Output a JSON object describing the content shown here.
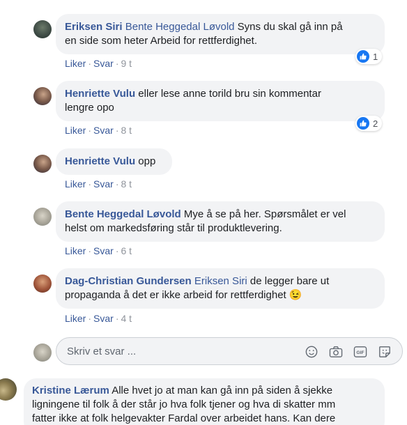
{
  "replies": [
    {
      "author": "Eriksen Siri",
      "mention": "Bente Heggedal Løvold",
      "text_line1": " Syns du skal gå inn på",
      "text_line2": "en side som heter Arbeid for rettferdighet.",
      "like": "Liker",
      "reply": "Svar",
      "time": "9 t",
      "reaction_count": "1"
    },
    {
      "author": "Henriette Vulu",
      "text_line1": " eller lese anne torild bru sin kommentar",
      "text_line2": "lengre opo",
      "like": "Liker",
      "reply": "Svar",
      "time": "8 t",
      "reaction_count": "2"
    },
    {
      "author": "Henriette Vulu",
      "text_line1": " opp",
      "like": "Liker",
      "reply": "Svar",
      "time": "8 t"
    },
    {
      "author": "Bente Heggedal Løvold",
      "text_line1": " Mye å se på her. Spørsmålet er vel",
      "text_line2": "helst om markedsføring står til produktlevering.",
      "like": "Liker",
      "reply": "Svar",
      "time": "6 t"
    },
    {
      "author": "Dag-Christian Gundersen",
      "mention": "Eriksen Siri",
      "text_line1": " de legger bare ut",
      "text_line2": "propaganda å det er ikke arbeid for rettferdighet",
      "emoji": "😉",
      "like": "Liker",
      "reply": "Svar",
      "time": "4 t"
    }
  ],
  "composer": {
    "placeholder": "Skriv et svar ...",
    "icons": [
      "emoji-icon",
      "camera-icon",
      "gif-icon",
      "sticker-icon"
    ],
    "gif_label": "GIF"
  },
  "comment": {
    "author": "Kristine Lærum",
    "line1": " Alle hvet jo at man kan gå inn på siden å sjekke",
    "line2": "ligningene til folk å der står jo hva folk tjener og hva di skatter mm",
    "line3": "fatter ikke at folk helgevakter Fardal over arbeidet hans. Kan dere"
  },
  "colors": {
    "link": "#385898",
    "bubble": "#f2f3f5",
    "like_blue": "#1877f2"
  },
  "separator": "·"
}
